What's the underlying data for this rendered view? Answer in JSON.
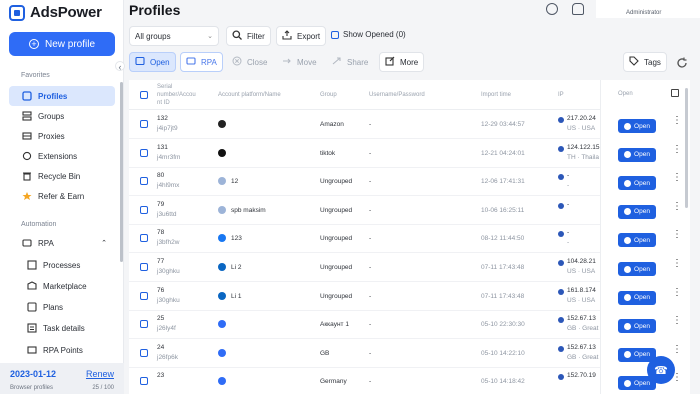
{
  "app": {
    "name": "AdsPower",
    "page_title": "Profiles",
    "user": "Administrator"
  },
  "sidebar": {
    "new_profile": "New profile",
    "favorites_label": "Favorites",
    "automation_label": "Automation",
    "favorites": [
      {
        "label": "Profiles",
        "icon": "profiles-icon"
      },
      {
        "label": "Groups",
        "icon": "groups-icon"
      },
      {
        "label": "Proxies",
        "icon": "proxies-icon"
      },
      {
        "label": "Extensions",
        "icon": "extensions-icon"
      },
      {
        "label": "Recycle Bin",
        "icon": "recycle-bin-icon"
      },
      {
        "label": "Refer & Earn",
        "icon": "refer-earn-icon"
      }
    ],
    "automation": [
      {
        "label": "RPA",
        "icon": "rpa-icon"
      },
      {
        "label": "Processes",
        "icon": "processes-icon"
      },
      {
        "label": "Marketplace",
        "icon": "marketplace-icon"
      },
      {
        "label": "Plans",
        "icon": "plans-icon"
      },
      {
        "label": "Task details",
        "icon": "task-details-icon"
      },
      {
        "label": "RPA Points",
        "icon": "rpa-points-icon"
      }
    ],
    "date": "2023-01-12",
    "renew": "Renew",
    "browser_profiles_label": "Browser profiles",
    "browser_profiles_count": "25 / 100"
  },
  "toolbar": {
    "group_select": "All groups",
    "filter": "Filter",
    "export": "Export",
    "show_opened": "Show Opened (0)"
  },
  "actions": {
    "open": "Open",
    "rpa": "RPA",
    "close": "Close",
    "move": "Move",
    "share": "Share",
    "more": "More",
    "tags": "Tags"
  },
  "table": {
    "headers": {
      "serial": "Serial",
      "serial2": "number/Accou",
      "serial3": "nt ID",
      "platform": "Account platform/Name",
      "group": "Group",
      "username": "Username/Password",
      "import_time": "Import time",
      "ip": "IP",
      "open": "Open"
    },
    "rows": [
      {
        "serial": "132",
        "id": "j4ip7jt9",
        "platform_icon": "amazon-icon",
        "color": "#222",
        "name": "",
        "group": "Amazon",
        "username": "-",
        "time": "12-29 03:44:57",
        "ip": "217.20.24",
        "ip2": "US · USA",
        "open": "Open"
      },
      {
        "serial": "131",
        "id": "j4mr3fm",
        "platform_icon": "tiktok-icon",
        "color": "#111",
        "name": "",
        "group": "tiktok",
        "username": "-",
        "time": "12-21 04:24:01",
        "ip": "124.122.15",
        "ip2": "TH · Thaila",
        "open": "Open"
      },
      {
        "serial": "80",
        "id": "j4hl9mx",
        "platform_icon": "globe-icon",
        "color": "#9db4d8",
        "name": "12",
        "group": "Ungrouped",
        "username": "-",
        "time": "12-06 17:41:31",
        "ip": "-",
        "ip2": "-",
        "open": "Open"
      },
      {
        "serial": "79",
        "id": "j3u6ttd",
        "platform_icon": "globe-icon",
        "color": "#9db4d8",
        "name": "spb maksim",
        "group": "Ungrouped",
        "username": "-",
        "time": "10-06 16:25:11",
        "ip": "-",
        "ip2": "",
        "open": "Open"
      },
      {
        "serial": "78",
        "id": "j3bfh2w",
        "platform_icon": "facebook-icon",
        "color": "#1877f2",
        "name": "123",
        "group": "Ungrouped",
        "username": "-",
        "time": "08-12 11:44:50",
        "ip": "-",
        "ip2": "-",
        "open": "Open"
      },
      {
        "serial": "77",
        "id": "j30ghku",
        "platform_icon": "linkedin-icon",
        "color": "#0a66c2",
        "name": "Li 2",
        "group": "Ungrouped",
        "username": "-",
        "time": "07-11 17:43:48",
        "ip": "104.28.21",
        "ip2": "US · USA",
        "open": "Open"
      },
      {
        "serial": "76",
        "id": "j30ghku",
        "platform_icon": "linkedin-icon",
        "color": "#0a66c2",
        "name": "Li 1",
        "group": "Ungrouped",
        "username": "-",
        "time": "07-11 17:43:48",
        "ip": "161.8.174",
        "ip2": "US · USA",
        "open": "Open"
      },
      {
        "serial": "25",
        "id": "j26ly4f",
        "platform_icon": "globe-icon",
        "color": "#2f6cf6",
        "name": "",
        "group": "Аккаунт 1",
        "username": "-",
        "time": "05-10 22:30:30",
        "ip": "152.67.13",
        "ip2": "GB · Great",
        "open": "Open"
      },
      {
        "serial": "24",
        "id": "j26fp6k",
        "platform_icon": "globe-icon",
        "color": "#2f6cf6",
        "name": "",
        "group": "GB",
        "username": "-",
        "time": "05-10 14:22:10",
        "ip": "152.67.13",
        "ip2": "GB · Great",
        "open": "Open"
      },
      {
        "serial": "23",
        "id": "",
        "platform_icon": "globe-icon",
        "color": "#2f6cf6",
        "name": "",
        "group": "Germany",
        "username": "-",
        "time": "05-10 14:18:42",
        "ip": "152.70.19",
        "ip2": "",
        "open": "Open"
      }
    ]
  }
}
